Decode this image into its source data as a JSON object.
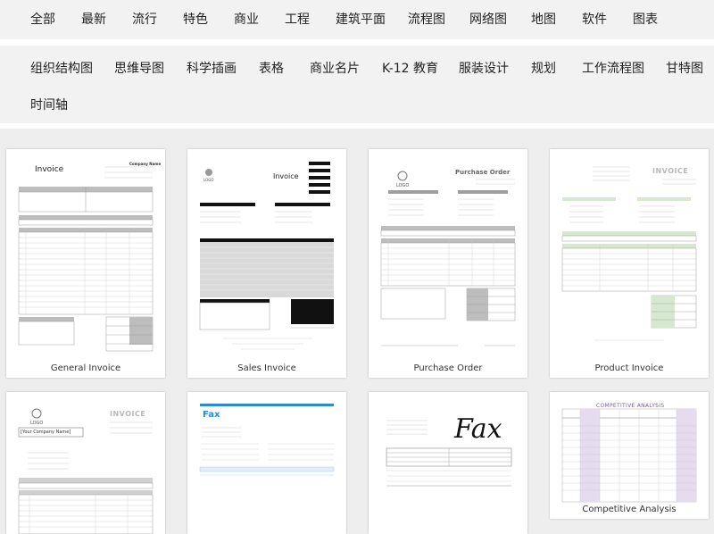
{
  "nav_primary": [
    "全部",
    "最新",
    "流行",
    "特色",
    "商业",
    "工程",
    "建筑平面",
    "流程图",
    "网络图",
    "地图",
    "软件",
    "图表"
  ],
  "nav_secondary": [
    "组织结构图",
    "思维导图",
    "科学插画",
    "表格",
    "商业名片",
    "K-12 教育",
    "服装设计",
    "规划",
    "工作流程图",
    "甘特图",
    "时间轴"
  ],
  "templates": [
    {
      "caption": "General Invoice",
      "doc_title": "Invoice",
      "company": "Company Name"
    },
    {
      "caption": "Sales Invoice",
      "doc_title": "Invoice",
      "logo": "LOGO"
    },
    {
      "caption": "Purchase Order",
      "doc_title": "Purchase Order",
      "logo": "LOGO"
    },
    {
      "caption": "Product Invoice",
      "doc_title": "INVOICE"
    },
    {
      "caption": "",
      "doc_title": "INVOICE",
      "logo": "LOGO",
      "company": "[Your Company Name]"
    },
    {
      "caption": "",
      "doc_title": "Fax"
    },
    {
      "caption": "",
      "doc_title": "Fax"
    },
    {
      "caption": "Competitive Analysis",
      "doc_title": "COMPETITIVE ANALYSIS"
    }
  ],
  "colors": {
    "nav_bg": "#f2f2f2",
    "grid_bg": "#eeeeee",
    "fax_blue": "#2a8bd0",
    "comp_purple": "#7d5aa6"
  }
}
